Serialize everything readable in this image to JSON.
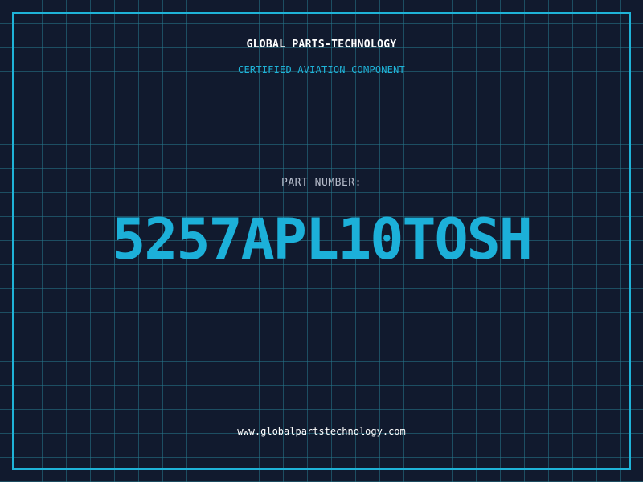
{
  "header": {
    "company": "GLOBAL PARTS-TECHNOLOGY",
    "subtitle": "CERTIFIED AVIATION COMPONENT"
  },
  "part": {
    "label": "PART NUMBER:",
    "number": "5257APL10TOSH"
  },
  "footer": {
    "website": "www.globalpartstechnology.com"
  },
  "colors": {
    "background": "#111a2e",
    "accent": "#1fb3d8",
    "grid": "#26788c",
    "text": "#ffffff",
    "label": "#b6bccb"
  }
}
